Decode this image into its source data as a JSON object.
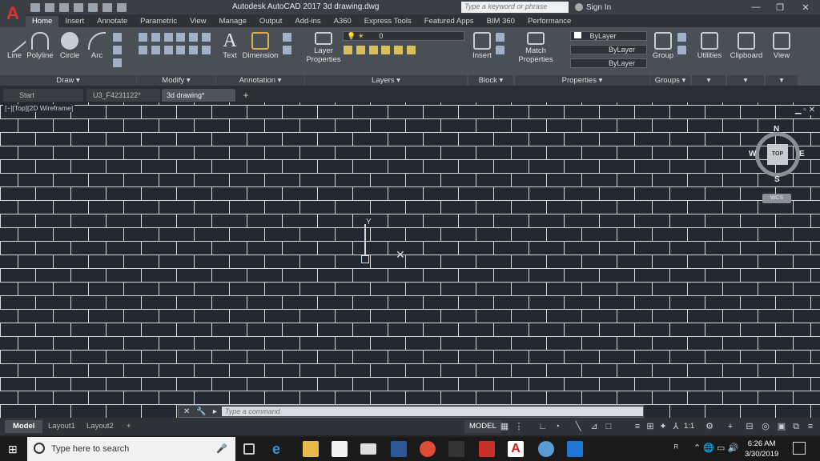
{
  "app": {
    "title": "Autodesk AutoCAD 2017    3d drawing.dwg",
    "search_placeholder": "Type a keyword or phrase",
    "signin_label": "Sign In"
  },
  "ribbon_tabs": [
    "Home",
    "Insert",
    "Annotate",
    "Parametric",
    "View",
    "Manage",
    "Output",
    "Add-ins",
    "A360",
    "Express Tools",
    "Featured Apps",
    "BIM 360",
    "Performance"
  ],
  "ribbon": {
    "draw": {
      "line": "Line",
      "polyline": "Polyline",
      "circle": "Circle",
      "arc": "Arc",
      "panel": "Draw ▾"
    },
    "modify": {
      "panel": "Modify ▾"
    },
    "annotation": {
      "text": "Text",
      "dimension": "Dimension",
      "panel": "Annotation ▾"
    },
    "layers": {
      "layer_props_l1": "Layer",
      "layer_props_l2": "Properties",
      "current_layer": "0",
      "panel": "Layers ▾"
    },
    "block": {
      "insert": "Insert",
      "panel": "Block ▾"
    },
    "properties": {
      "match_l1": "Match",
      "match_l2": "Properties",
      "bylayer1": "ByLayer",
      "bylayer2": "ByLayer",
      "bylayer3": "ByLayer",
      "panel": "Properties ▾"
    },
    "groups": {
      "group": "Group",
      "panel": "Groups ▾"
    },
    "utilities": "Utilities",
    "clipboard": "Clipboard",
    "view": "View"
  },
  "doc_tabs": [
    "Start",
    "U3_F4231122*",
    "3d drawing*"
  ],
  "viewport": {
    "label": "[−][Top][2D Wireframe]",
    "compass": {
      "n": "N",
      "s": "S",
      "e": "E",
      "w": "W",
      "top": "TOP",
      "wcs": "WCS"
    },
    "ucs_y": "Y"
  },
  "command": {
    "placeholder": "Type a command"
  },
  "layout_tabs": [
    "Model",
    "Layout1",
    "Layout2"
  ],
  "status": {
    "model": "MODEL",
    "scale": "1:1"
  },
  "taskbar": {
    "search": "Type here to search",
    "time": "6:26 AM",
    "date": "3/30/2019"
  },
  "colors": {
    "canvas": "#222933",
    "brick_line": "#d9d9d9",
    "ribbon": "#4a4f56",
    "accent_red": "#e03030"
  }
}
